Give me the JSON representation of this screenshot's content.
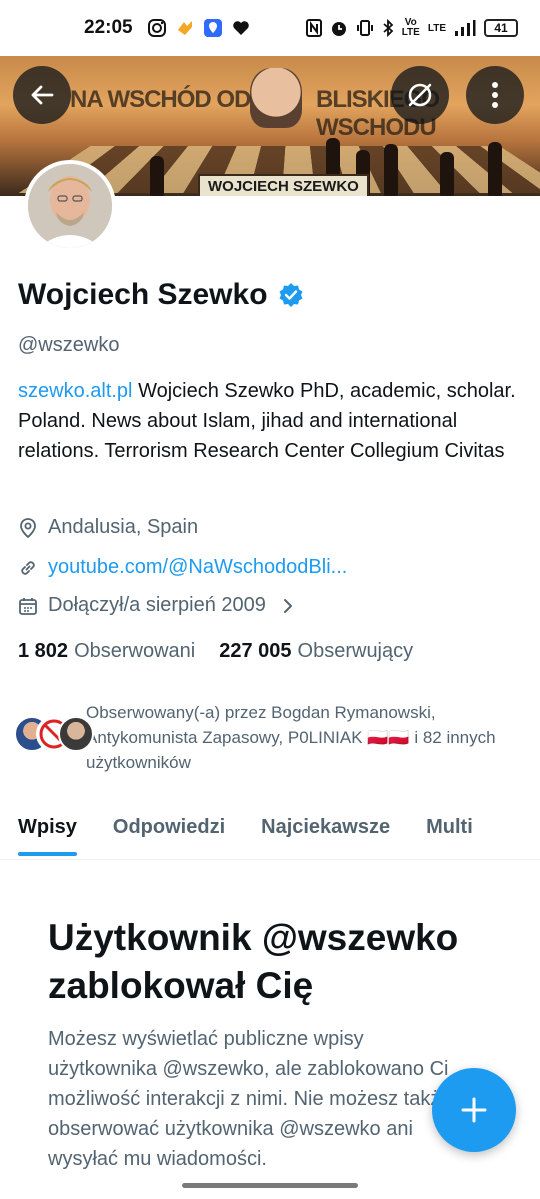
{
  "status_bar": {
    "time": "22:05",
    "battery": "41",
    "network": "LTE",
    "icons": [
      "instagram-icon",
      "app-icon",
      "location-icon",
      "heart-icon",
      "nfc-icon",
      "alarm-icon",
      "vibrate-icon",
      "bluetooth-icon",
      "volte-icon",
      "signal-icon",
      "battery-icon"
    ]
  },
  "banner": {
    "text_left": "NA WSCHÓD OD",
    "text_right": "BLISKIEGO WSCHODU",
    "name_plate": "WOJCIECH SZEWKO"
  },
  "header_buttons": [
    "back-arrow-icon",
    "grok-icon",
    "more-vertical-icon"
  ],
  "profile": {
    "name": "Wojciech Szewko",
    "handle": "@wszewko",
    "bio_link": "szewko.alt.pl",
    "bio_text": "Wojciech Szewko PhD, academic, scholar. Poland. News about Islam, jihad and international relations. Terrorism Research Center Collegium Civitas",
    "location": "Andalusia, Spain",
    "website": "youtube.com/@NaWschododBli...",
    "joined": "Dołączył/a sierpień 2009",
    "following_count": "1 802",
    "following_label": "Obserwowani",
    "followers_count": "227 005",
    "followers_label": "Obserwujący",
    "followed_by": "Obserwowany(-a) przez Bogdan Rymanowski, Antykomunista Zapasowy, P0LINIAK 🇵🇱🇵🇱 i 82 innych użytkowników"
  },
  "tabs": [
    {
      "label": "Wpisy",
      "active": true
    },
    {
      "label": "Odpowiedzi",
      "active": false
    },
    {
      "label": "Najciekawsze",
      "active": false
    },
    {
      "label": "Multi",
      "active": false
    }
  ],
  "blocked": {
    "title": "Użytkownik @wszewko zablokował Cię",
    "body": "Możesz wyświetlać publiczne wpisy użytkownika @wszewko, ale zablokowano Ci możliwość interakcji z nimi. Nie możesz także obserwować użytkownika @wszewko ani wysyłać mu wiadomości."
  },
  "colors": {
    "accent": "#1d9bf0",
    "text_primary": "#0f1419",
    "text_secondary": "#536471"
  }
}
